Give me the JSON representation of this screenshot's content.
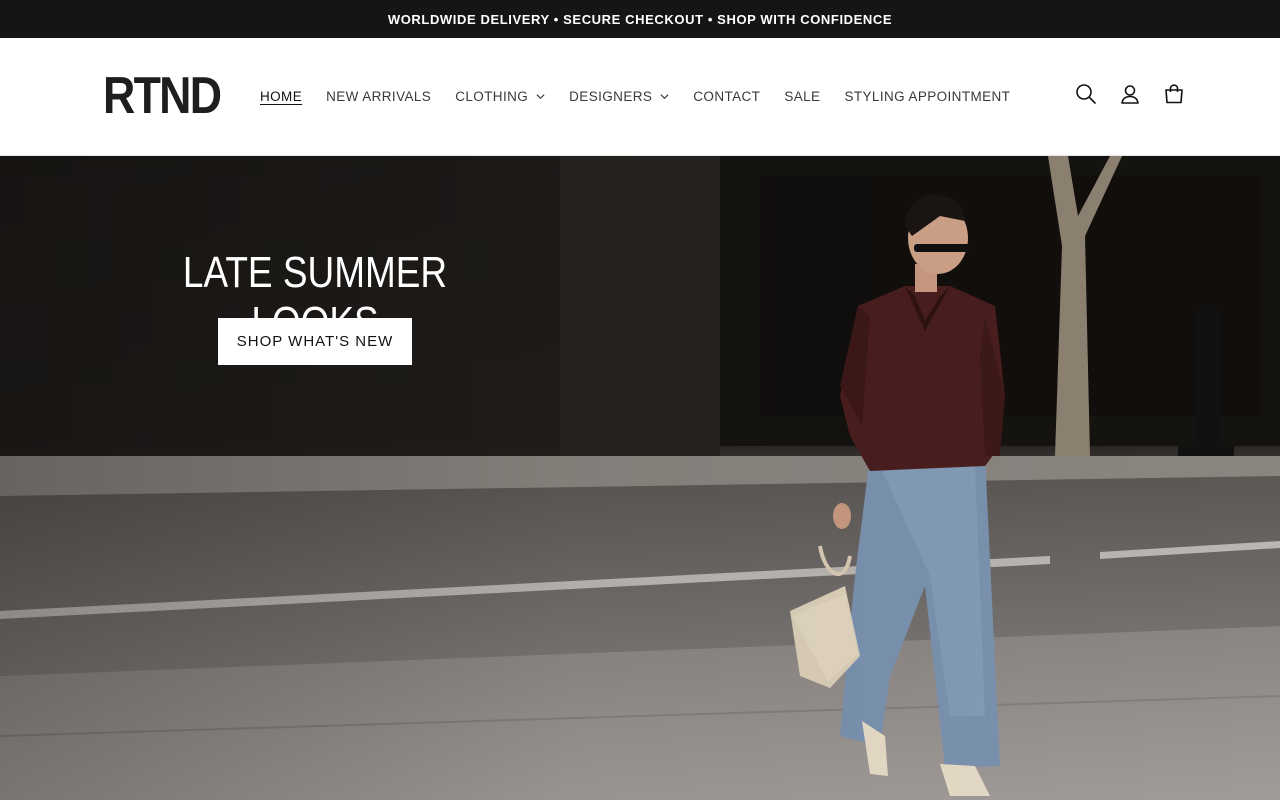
{
  "announcement": {
    "text": "WORLDWIDE DELIVERY • SECURE CHECKOUT • SHOP WITH CONFIDENCE"
  },
  "header": {
    "logo_text": "RTND",
    "nav": [
      {
        "label": "HOME",
        "active": true,
        "has_dropdown": false
      },
      {
        "label": "NEW ARRIVALS",
        "active": false,
        "has_dropdown": false
      },
      {
        "label": "CLOTHING",
        "active": false,
        "has_dropdown": true
      },
      {
        "label": "DESIGNERS",
        "active": false,
        "has_dropdown": true
      },
      {
        "label": "CONTACT",
        "active": false,
        "has_dropdown": false
      },
      {
        "label": "SALE",
        "active": false,
        "has_dropdown": false
      },
      {
        "label": "STYLING APPOINTMENT",
        "active": false,
        "has_dropdown": false
      }
    ],
    "icons": [
      "search-icon",
      "account-icon",
      "cart-icon"
    ]
  },
  "hero": {
    "title": "LATE SUMMER LOOKS",
    "button_label": "SHOP WHAT'S NEW"
  },
  "colors": {
    "announcement_bg": "#151515",
    "text_primary": "#121212",
    "button_bg": "#ffffff"
  }
}
